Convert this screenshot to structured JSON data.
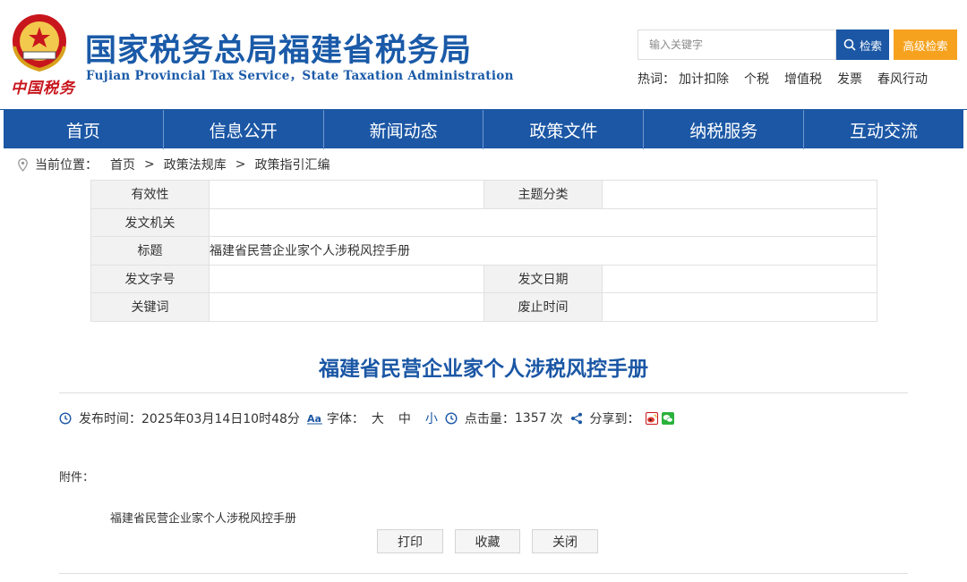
{
  "header": {
    "slogan": "中国税务",
    "title": "国家税务总局福建省税务局",
    "subtitle": "Fujian Provincial Tax Service，State Taxation Administration",
    "search_placeholder": "输入关键字",
    "search_label": "检索",
    "advanced_label": "高级检索",
    "hot_label": "热词：",
    "hot_words": [
      "加计扣除",
      "个税",
      "增值税",
      "发票",
      "春风行动"
    ]
  },
  "nav": [
    "首页",
    "信息公开",
    "新闻动态",
    "政策文件",
    "纳税服务",
    "互动交流"
  ],
  "breadcrumb": {
    "label": "当前位置：",
    "items": [
      "首页",
      "政策法规库",
      "政策指引汇编"
    ],
    "separator": ">"
  },
  "info": {
    "validity_label": "有效性",
    "validity_value": "",
    "topic_label": "主题分类",
    "topic_value": "",
    "issuer_label": "发文机关",
    "issuer_value": "",
    "title_label": "标题",
    "title_value": "福建省民营企业家个人涉税风控手册",
    "docno_label": "发文字号",
    "docno_value": "",
    "date_label": "发文日期",
    "date_value": "",
    "keywords_label": "关键词",
    "keywords_value": "",
    "expiry_label": "废止时间",
    "expiry_value": ""
  },
  "article": {
    "title": "福建省民营企业家个人涉税风控手册",
    "publish_label": "发布时间：",
    "publish_time": "2025年03月14日10时48分",
    "font_label": "字体：",
    "font_large": "大",
    "font_medium": "中",
    "font_small": "小",
    "clicks_label": "点击量：",
    "clicks": "1357",
    "clicks_unit": "次",
    "share_label": "分享到：",
    "attachment_label": "附件：",
    "attachment_name": "福建省民营企业家个人涉税风控手册"
  },
  "buttons": {
    "print": "打印",
    "favorite": "收藏",
    "close": "关闭"
  },
  "colors": {
    "brand_blue": "#1b57a5",
    "accent_orange": "#f6a21e",
    "emblem_red": "#c8161d"
  }
}
